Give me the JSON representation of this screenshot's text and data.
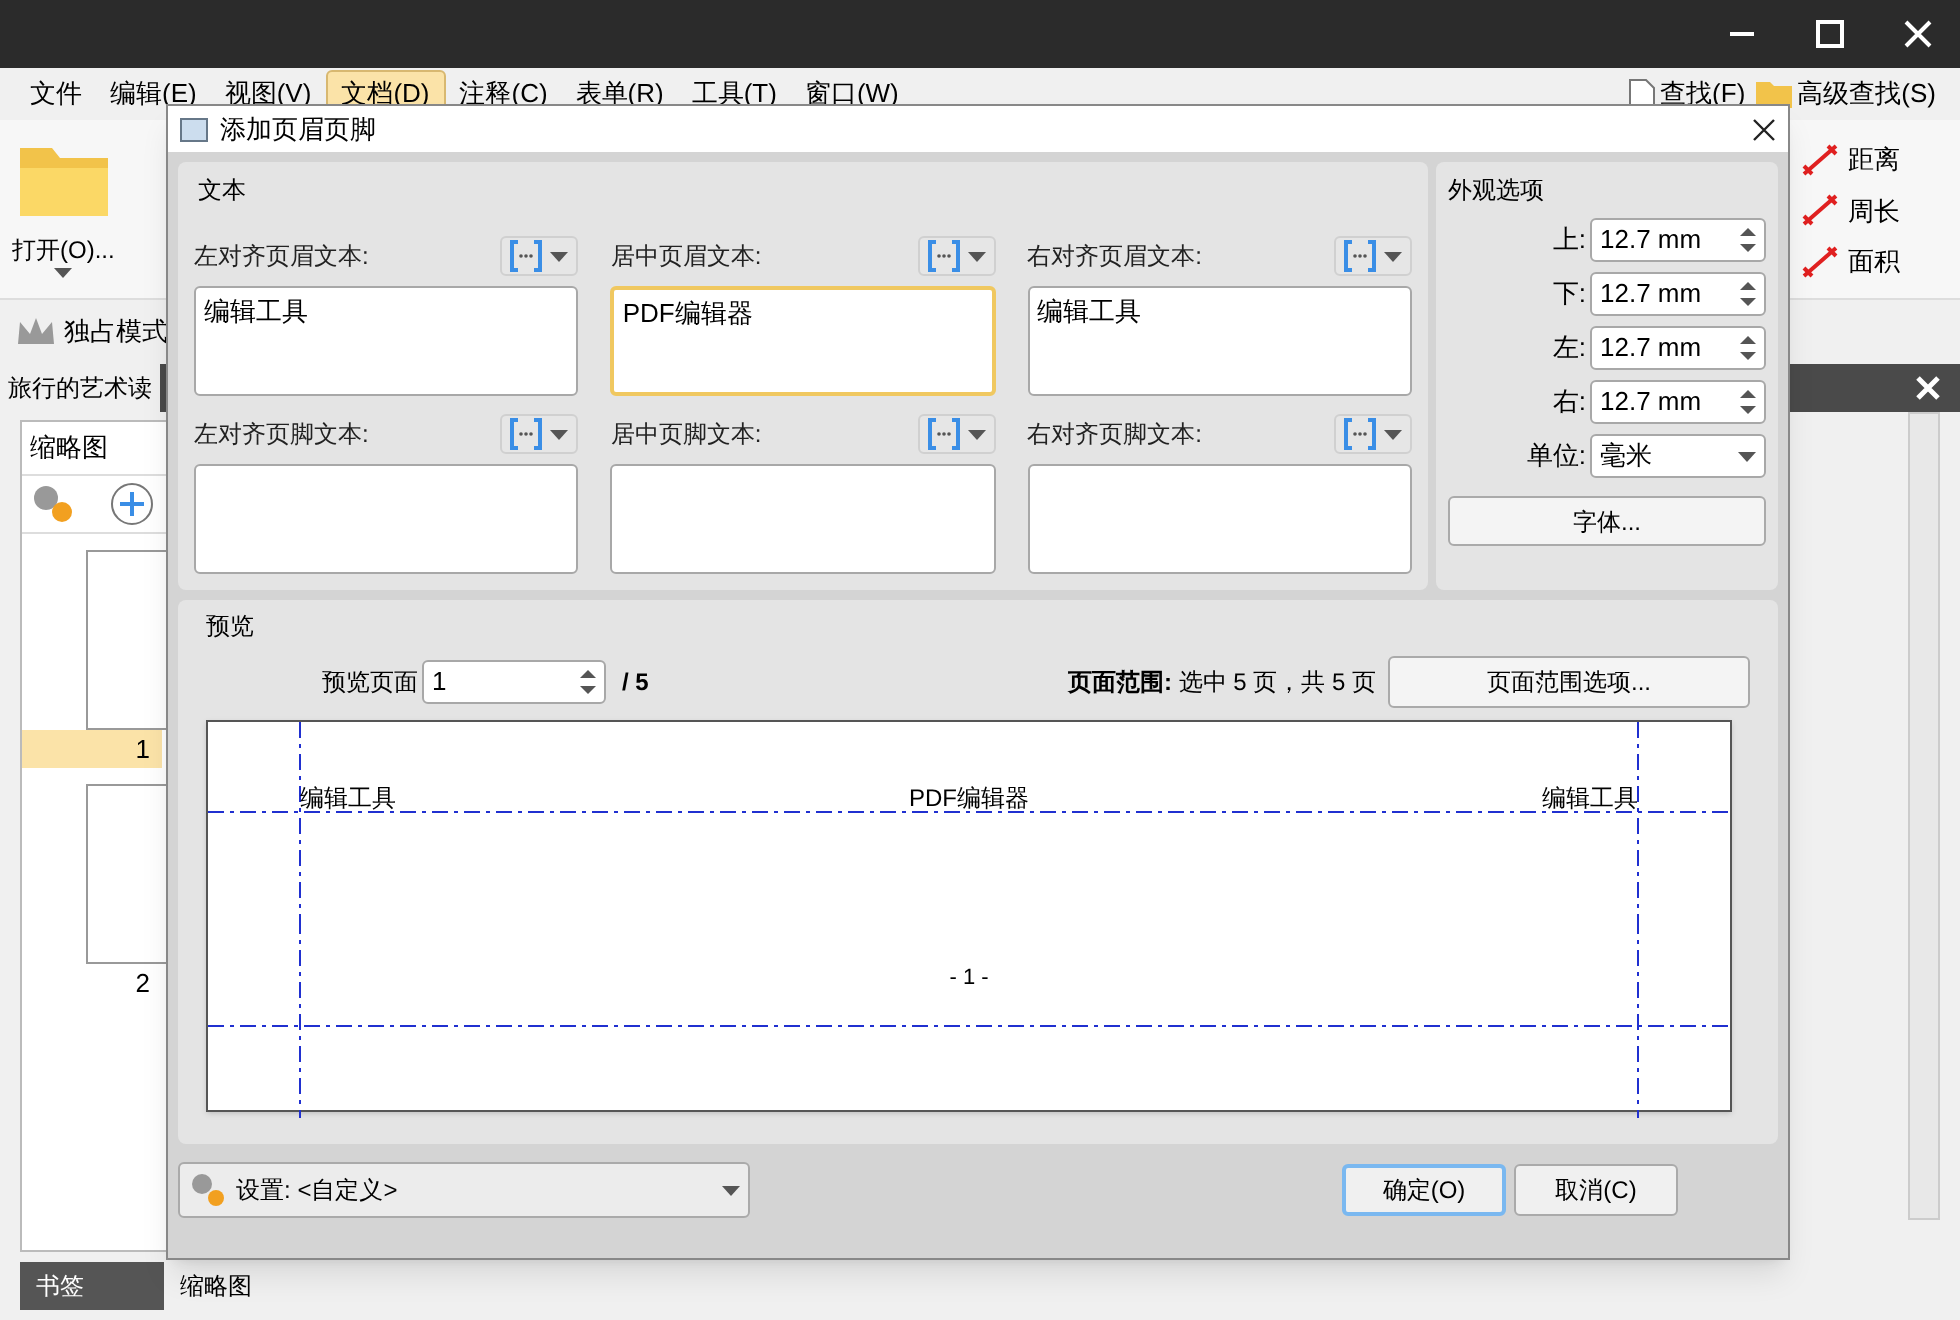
{
  "menu": [
    {
      "label": "文件",
      "selected": false
    },
    {
      "label": "编辑(E)",
      "selected": false
    },
    {
      "label": "视图(V)",
      "selected": false
    },
    {
      "label": "文档(D)",
      "selected": true
    },
    {
      "label": "注释(C)",
      "selected": false
    },
    {
      "label": "表单(R)",
      "selected": false
    },
    {
      "label": "工具(T)",
      "selected": false
    },
    {
      "label": "窗口(W)",
      "selected": false
    }
  ],
  "find_buttons": [
    "查找(F)",
    "高级查找(S)"
  ],
  "open_button": "打开(O)...",
  "measure_tools": [
    "距离",
    "周长",
    "面积"
  ],
  "exclusive_mode": "独占模式",
  "document_tab": "旅行的艺术读",
  "thumbnails": {
    "title": "缩略图",
    "pages": [
      {
        "label": "1",
        "selected": true
      },
      {
        "label": "2",
        "selected": false
      }
    ]
  },
  "bottom_tabs": [
    {
      "label": "书签",
      "selected": false
    },
    {
      "label": "缩略图",
      "selected": true
    }
  ],
  "dialog": {
    "title": "添加页眉页脚",
    "text_group": {
      "title": "文本",
      "fields": [
        {
          "label": "左对齐页眉文本:",
          "value": "编辑工具",
          "focused": false
        },
        {
          "label": "居中页眉文本:",
          "value": "PDF编辑器",
          "focused": true
        },
        {
          "label": "右对齐页眉文本:",
          "value": "编辑工具",
          "focused": false
        },
        {
          "label": "左对齐页脚文本:",
          "focused": false
        },
        {
          "label": "居中页脚文本:",
          "focused": false
        },
        {
          "label": "右对齐页脚文本:",
          "focused": false
        }
      ]
    },
    "appearance": {
      "title": "外观选项",
      "margins": [
        {
          "label": "上:",
          "value": "12.7 mm"
        },
        {
          "label": "下:",
          "value": "12.7 mm"
        },
        {
          "label": "左:",
          "value": "12.7 mm"
        },
        {
          "label": "右:",
          "value": "12.7 mm"
        }
      ],
      "unit": {
        "label": "单位:",
        "value": "毫米"
      },
      "font_button": "字体..."
    },
    "preview": {
      "title": "预览",
      "page_label": "预览页面",
      "page_value": "1",
      "page_total": "/ 5",
      "range_text": "**页面范围:** 选中 5 页，共 5 页",
      "range_button": "页面范围选项...",
      "header_left": "编辑工具",
      "header_center": "PDF编辑器",
      "header_right": "编辑工具",
      "footer_center": "- 1 -"
    },
    "settings": {
      "label": "设置:",
      "value": "<自定义>"
    },
    "buttons": [
      {
        "label": "确定(O)",
        "default": true
      },
      {
        "label": "取消(C)",
        "default": false
      }
    ]
  }
}
